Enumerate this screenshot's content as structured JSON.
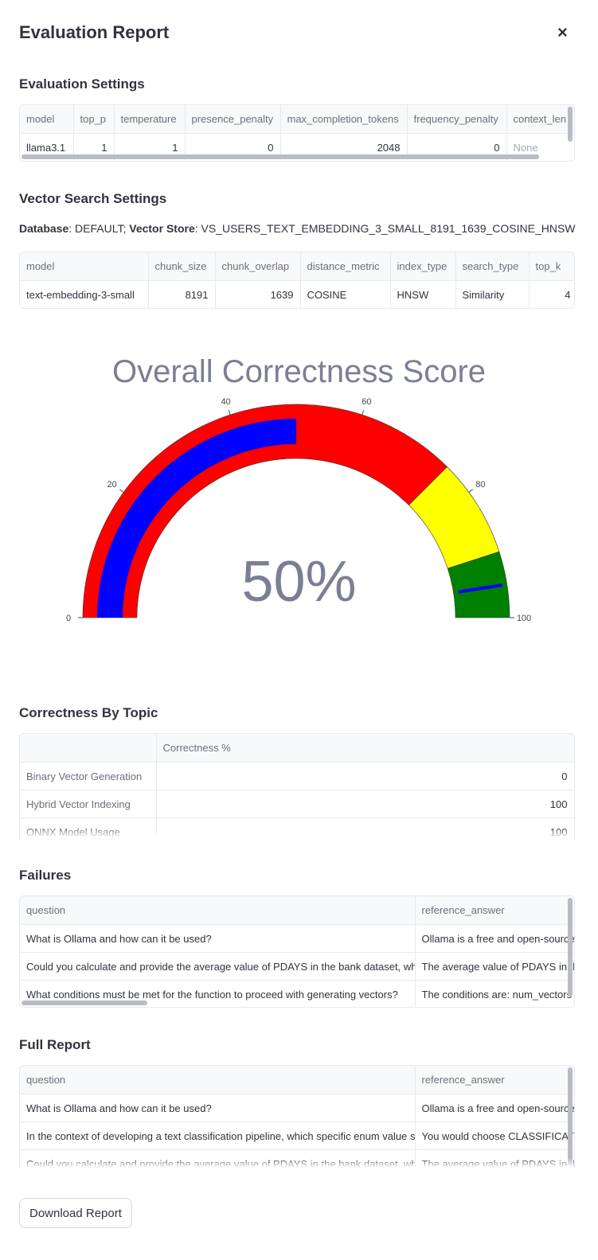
{
  "dialog": {
    "title": "Evaluation Report",
    "close_label": "×"
  },
  "eval_settings": {
    "title": "Evaluation Settings",
    "columns": [
      "model",
      "top_p",
      "temperature",
      "presence_penalty",
      "max_completion_tokens",
      "frequency_penalty",
      "context_len"
    ],
    "row": [
      "llama3.1",
      "1",
      "1",
      "0",
      "2048",
      "0",
      "None"
    ]
  },
  "vector_settings": {
    "title": "Vector Search Settings",
    "db_label": "Database",
    "db_value": ": DEFAULT; ",
    "store_label": "Vector Store",
    "store_value": ": VS_USERS_TEXT_EMBEDDING_3_SMALL_8191_1639_COSINE_HNSW",
    "columns": [
      "model",
      "chunk_size",
      "chunk_overlap",
      "distance_metric",
      "index_type",
      "search_type",
      "top_k"
    ],
    "row": [
      "text-embedding-3-small",
      "8191",
      "1639",
      "COSINE",
      "HNSW",
      "Similarity",
      "4"
    ]
  },
  "gauge": {
    "title": "Overall Correctness Score",
    "value_text": "50%",
    "value": 50,
    "bar_value": 50,
    "range": [
      0,
      100
    ],
    "ticks": [
      "0",
      "20",
      "40",
      "60",
      "80",
      "100"
    ],
    "steps": [
      {
        "from": 0,
        "to": 75,
        "color": "#ff0000"
      },
      {
        "from": 75,
        "to": 90,
        "color": "#ffff00"
      },
      {
        "from": 90,
        "to": 100,
        "color": "#008000"
      }
    ],
    "bar_color": "#0000ff",
    "threshold": 95,
    "threshold_color": "#0000ff"
  },
  "topics": {
    "title": "Correctness By Topic",
    "column": "Correctness %",
    "rows": [
      {
        "topic": "Binary Vector Generation",
        "value": "0"
      },
      {
        "topic": "Hybrid Vector Indexing",
        "value": "100"
      },
      {
        "topic": "ONNX Model Usage",
        "value": "100"
      }
    ]
  },
  "failures": {
    "title": "Failures",
    "columns": [
      "question",
      "reference_answer"
    ],
    "rows": [
      [
        "What is Ollama and how can it be used?",
        "Ollama is a free and open-source"
      ],
      [
        "Could you calculate and provide the average value of PDAYS in the bank dataset, while",
        "The average value of PDAYS in the"
      ],
      [
        "What conditions must be met for the function to proceed with generating vectors?",
        "The conditions are: num_vectors"
      ]
    ]
  },
  "full_report": {
    "title": "Full Report",
    "columns": [
      "question",
      "reference_answer"
    ],
    "rows": [
      [
        "What is Ollama and how can it be used?",
        "Ollama is a free and open-source"
      ],
      [
        "In the context of developing a text classification pipeline, which specific enum value should",
        "You would choose CLASSIFICATION"
      ],
      [
        "Could you calculate and provide the average value of PDAYS in the bank dataset, while",
        "The average value of PDAYS in the"
      ]
    ]
  },
  "download_label": "Download Report"
}
